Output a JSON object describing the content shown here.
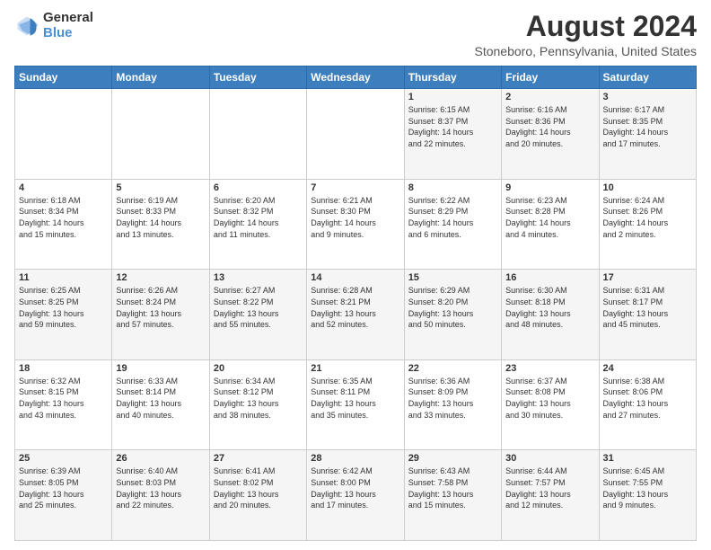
{
  "logo": {
    "line1": "General",
    "line2": "Blue"
  },
  "title": "August 2024",
  "subtitle": "Stoneboro, Pennsylvania, United States",
  "days_of_week": [
    "Sunday",
    "Monday",
    "Tuesday",
    "Wednesday",
    "Thursday",
    "Friday",
    "Saturday"
  ],
  "weeks": [
    [
      {
        "day": "",
        "info": ""
      },
      {
        "day": "",
        "info": ""
      },
      {
        "day": "",
        "info": ""
      },
      {
        "day": "",
        "info": ""
      },
      {
        "day": "1",
        "info": "Sunrise: 6:15 AM\nSunset: 8:37 PM\nDaylight: 14 hours\nand 22 minutes."
      },
      {
        "day": "2",
        "info": "Sunrise: 6:16 AM\nSunset: 8:36 PM\nDaylight: 14 hours\nand 20 minutes."
      },
      {
        "day": "3",
        "info": "Sunrise: 6:17 AM\nSunset: 8:35 PM\nDaylight: 14 hours\nand 17 minutes."
      }
    ],
    [
      {
        "day": "4",
        "info": "Sunrise: 6:18 AM\nSunset: 8:34 PM\nDaylight: 14 hours\nand 15 minutes."
      },
      {
        "day": "5",
        "info": "Sunrise: 6:19 AM\nSunset: 8:33 PM\nDaylight: 14 hours\nand 13 minutes."
      },
      {
        "day": "6",
        "info": "Sunrise: 6:20 AM\nSunset: 8:32 PM\nDaylight: 14 hours\nand 11 minutes."
      },
      {
        "day": "7",
        "info": "Sunrise: 6:21 AM\nSunset: 8:30 PM\nDaylight: 14 hours\nand 9 minutes."
      },
      {
        "day": "8",
        "info": "Sunrise: 6:22 AM\nSunset: 8:29 PM\nDaylight: 14 hours\nand 6 minutes."
      },
      {
        "day": "9",
        "info": "Sunrise: 6:23 AM\nSunset: 8:28 PM\nDaylight: 14 hours\nand 4 minutes."
      },
      {
        "day": "10",
        "info": "Sunrise: 6:24 AM\nSunset: 8:26 PM\nDaylight: 14 hours\nand 2 minutes."
      }
    ],
    [
      {
        "day": "11",
        "info": "Sunrise: 6:25 AM\nSunset: 8:25 PM\nDaylight: 13 hours\nand 59 minutes."
      },
      {
        "day": "12",
        "info": "Sunrise: 6:26 AM\nSunset: 8:24 PM\nDaylight: 13 hours\nand 57 minutes."
      },
      {
        "day": "13",
        "info": "Sunrise: 6:27 AM\nSunset: 8:22 PM\nDaylight: 13 hours\nand 55 minutes."
      },
      {
        "day": "14",
        "info": "Sunrise: 6:28 AM\nSunset: 8:21 PM\nDaylight: 13 hours\nand 52 minutes."
      },
      {
        "day": "15",
        "info": "Sunrise: 6:29 AM\nSunset: 8:20 PM\nDaylight: 13 hours\nand 50 minutes."
      },
      {
        "day": "16",
        "info": "Sunrise: 6:30 AM\nSunset: 8:18 PM\nDaylight: 13 hours\nand 48 minutes."
      },
      {
        "day": "17",
        "info": "Sunrise: 6:31 AM\nSunset: 8:17 PM\nDaylight: 13 hours\nand 45 minutes."
      }
    ],
    [
      {
        "day": "18",
        "info": "Sunrise: 6:32 AM\nSunset: 8:15 PM\nDaylight: 13 hours\nand 43 minutes."
      },
      {
        "day": "19",
        "info": "Sunrise: 6:33 AM\nSunset: 8:14 PM\nDaylight: 13 hours\nand 40 minutes."
      },
      {
        "day": "20",
        "info": "Sunrise: 6:34 AM\nSunset: 8:12 PM\nDaylight: 13 hours\nand 38 minutes."
      },
      {
        "day": "21",
        "info": "Sunrise: 6:35 AM\nSunset: 8:11 PM\nDaylight: 13 hours\nand 35 minutes."
      },
      {
        "day": "22",
        "info": "Sunrise: 6:36 AM\nSunset: 8:09 PM\nDaylight: 13 hours\nand 33 minutes."
      },
      {
        "day": "23",
        "info": "Sunrise: 6:37 AM\nSunset: 8:08 PM\nDaylight: 13 hours\nand 30 minutes."
      },
      {
        "day": "24",
        "info": "Sunrise: 6:38 AM\nSunset: 8:06 PM\nDaylight: 13 hours\nand 27 minutes."
      }
    ],
    [
      {
        "day": "25",
        "info": "Sunrise: 6:39 AM\nSunset: 8:05 PM\nDaylight: 13 hours\nand 25 minutes."
      },
      {
        "day": "26",
        "info": "Sunrise: 6:40 AM\nSunset: 8:03 PM\nDaylight: 13 hours\nand 22 minutes."
      },
      {
        "day": "27",
        "info": "Sunrise: 6:41 AM\nSunset: 8:02 PM\nDaylight: 13 hours\nand 20 minutes."
      },
      {
        "day": "28",
        "info": "Sunrise: 6:42 AM\nSunset: 8:00 PM\nDaylight: 13 hours\nand 17 minutes."
      },
      {
        "day": "29",
        "info": "Sunrise: 6:43 AM\nSunset: 7:58 PM\nDaylight: 13 hours\nand 15 minutes."
      },
      {
        "day": "30",
        "info": "Sunrise: 6:44 AM\nSunset: 7:57 PM\nDaylight: 13 hours\nand 12 minutes."
      },
      {
        "day": "31",
        "info": "Sunrise: 6:45 AM\nSunset: 7:55 PM\nDaylight: 13 hours\nand 9 minutes."
      }
    ]
  ]
}
